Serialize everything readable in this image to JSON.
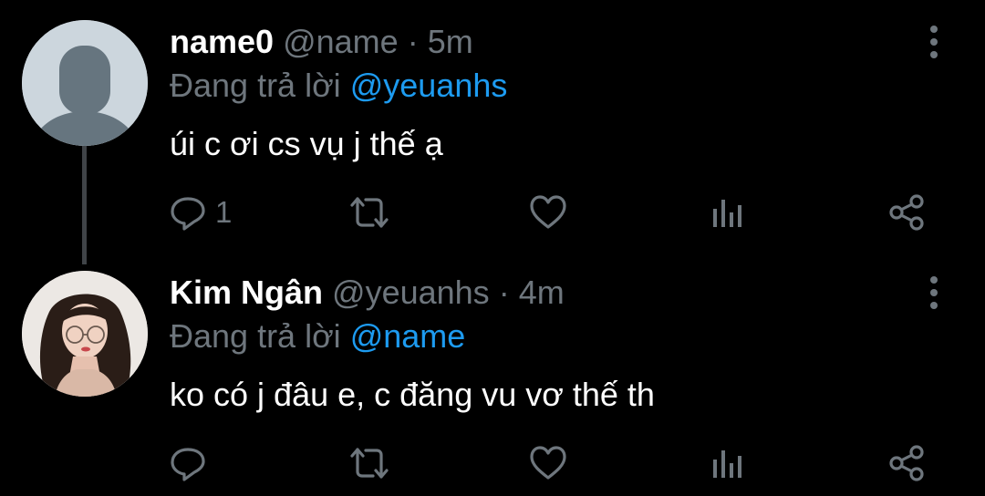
{
  "tweets": [
    {
      "display_name": "name0",
      "handle": "@name",
      "separator": "·",
      "time": "5m",
      "reply_prefix": "Đang trả lời",
      "reply_to": "@yeuanhs",
      "text": "úi c ơi cs vụ j thế ạ",
      "reply_count": "1",
      "avatar": "default-profile-avatar"
    },
    {
      "display_name": "Kim Ngân",
      "handle": "@yeuanhs",
      "separator": "·",
      "time": "4m",
      "reply_prefix": "Đang trả lời",
      "reply_to": "@name",
      "text": "ko có j đâu e, c đăng vu vơ thế th",
      "reply_count": "",
      "avatar": "profile-photo"
    }
  ],
  "icons": {
    "reply": "reply-icon",
    "retweet": "retweet-icon",
    "like": "heart-icon",
    "analytics": "analytics-icon",
    "share": "share-icon",
    "more": "more-vertical-icon"
  },
  "colors": {
    "background": "#000000",
    "text": "#ffffff",
    "muted": "#6e767d",
    "link": "#1d9bf0",
    "thread_line": "#404448"
  }
}
